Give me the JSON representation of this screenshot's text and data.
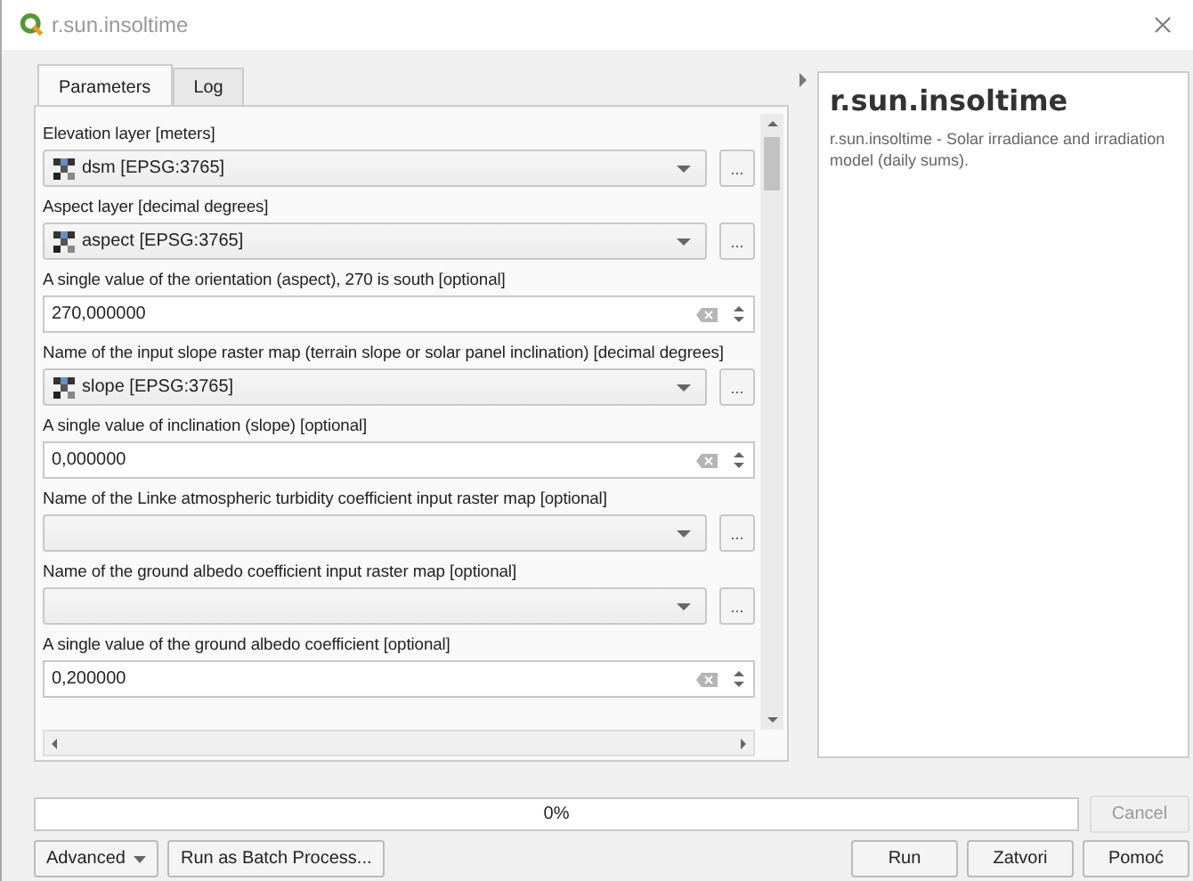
{
  "window": {
    "title": "r.sun.insoltime"
  },
  "tabs": [
    {
      "label": "Parameters",
      "selected": true
    },
    {
      "label": "Log",
      "selected": false
    }
  ],
  "parameters": [
    {
      "kind": "layer",
      "label": "Elevation layer [meters]",
      "value": "dsm [EPSG:3765]",
      "browse": "..."
    },
    {
      "kind": "layer",
      "label": "Aspect layer [decimal degrees]",
      "value": "aspect [EPSG:3765]",
      "browse": "..."
    },
    {
      "kind": "number",
      "label": "A single value of the orientation (aspect), 270 is south [optional]",
      "value": "270,000000"
    },
    {
      "kind": "layer",
      "label": "Name of the input slope raster map (terrain slope or solar panel inclination) [decimal degrees]",
      "value": "slope [EPSG:3765]",
      "browse": "..."
    },
    {
      "kind": "number",
      "label": "A single value of inclination (slope) [optional]",
      "value": "0,000000"
    },
    {
      "kind": "layer",
      "label": "Name of the Linke atmospheric turbidity coefficient input raster map [optional]",
      "browse": "..."
    },
    {
      "kind": "layer",
      "label": "Name of the ground albedo coefficient input raster map [optional]",
      "browse": "..."
    },
    {
      "kind": "number",
      "label": "A single value of the ground albedo coefficient [optional]",
      "value": "0,200000"
    }
  ],
  "help": {
    "title": "r.sun.insoltime",
    "text": "r.sun.insoltime - Solar irradiance and irradiation model (daily sums)."
  },
  "progress": {
    "level": 0,
    "reading": "0%"
  },
  "buttons": [
    {
      "label": "Cancel",
      "disabled": true
    },
    {
      "label": "Advanced",
      "kind": "menu"
    },
    {
      "label": "Run as Batch Process...",
      "kind": "plain"
    },
    {
      "label": "Run",
      "kind": "plain"
    },
    {
      "label": "Zatvori",
      "kind": "plain"
    },
    {
      "label": "Pomoć",
      "kind": "plain"
    }
  ]
}
